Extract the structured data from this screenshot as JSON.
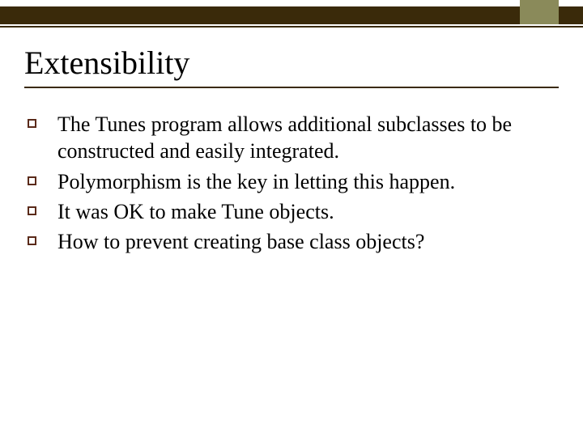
{
  "slide": {
    "title": "Extensibility",
    "bullets": [
      "The Tunes program allows additional subclasses to be constructed and easily integrated.",
      "Polymorphism is the key in letting this happen.",
      "It was OK to make Tune objects.",
      "How to prevent creating base class objects?"
    ]
  }
}
